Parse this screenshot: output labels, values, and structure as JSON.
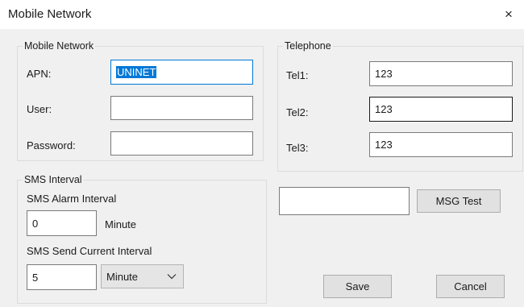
{
  "window": {
    "title": "Mobile Network",
    "close_glyph": "×"
  },
  "mobile_network": {
    "legend": "Mobile Network",
    "apn_label": "APN:",
    "apn_value": "UNINET",
    "user_label": "User:",
    "user_value": "",
    "password_label": "Password:",
    "password_value": ""
  },
  "telephone": {
    "legend": "Telephone",
    "fields": [
      {
        "label": "Tel1:",
        "value": "123"
      },
      {
        "label": "Tel2:",
        "value": "123"
      },
      {
        "label": "Tel3:",
        "value": "123"
      }
    ]
  },
  "sms_interval": {
    "legend": "SMS Interval",
    "alarm_label": "SMS Alarm Interval",
    "alarm_value": "0",
    "alarm_unit": "Minute",
    "send_label": "SMS Send Current Interval",
    "send_value": "5",
    "send_unit_selected": "Minute"
  },
  "msg_test": {
    "input_value": "",
    "button_label": "MSG Test"
  },
  "actions": {
    "save_label": "Save",
    "cancel_label": "Cancel"
  },
  "icons": {
    "close": "close-icon",
    "dropdown": "chevron-down-icon"
  },
  "colors": {
    "selection": "#0078d7",
    "panel_bg": "#f0f0f0",
    "button_bg": "#e1e1e1"
  }
}
